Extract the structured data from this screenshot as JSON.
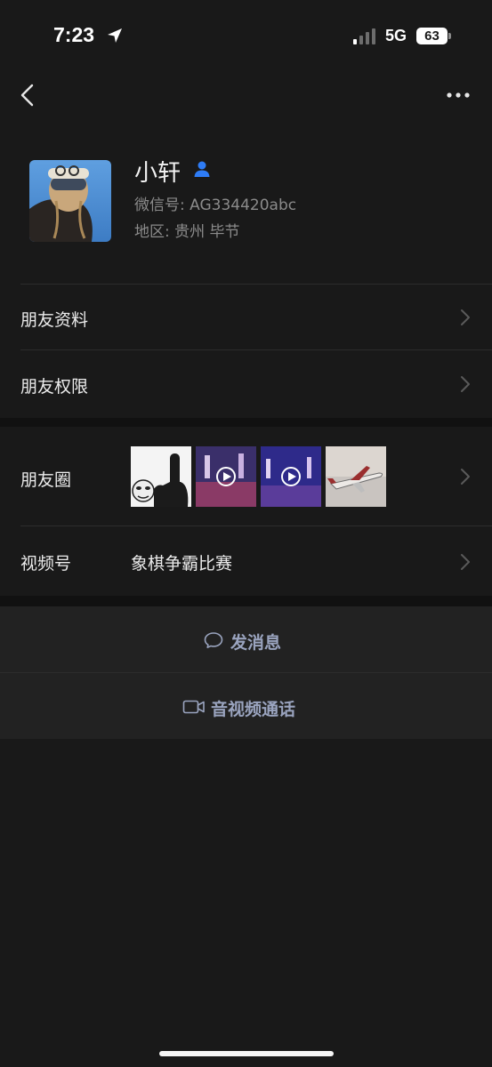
{
  "status_bar": {
    "time": "7:23",
    "network": "5G",
    "battery": "63"
  },
  "profile": {
    "name": "小轩",
    "wechat_id": "微信号: AG334420abc",
    "region": "地区: 贵州 毕节"
  },
  "list": {
    "friend_info": "朋友资料",
    "friend_permissions": "朋友权限",
    "moments": "朋友圈",
    "channels": "视频号",
    "channels_value": "象棋争霸比赛"
  },
  "actions": {
    "send_message": "发消息",
    "video_call": "音视频通话"
  },
  "colors": {
    "background": "#191919",
    "action_text": "#9aa4bf",
    "contact_badge": "#2e7cf6"
  },
  "icons": {
    "back": "chevron-left-icon",
    "more": "more-dots-icon",
    "message": "chat-bubble-icon",
    "video": "video-camera-icon",
    "contact": "person-icon"
  }
}
